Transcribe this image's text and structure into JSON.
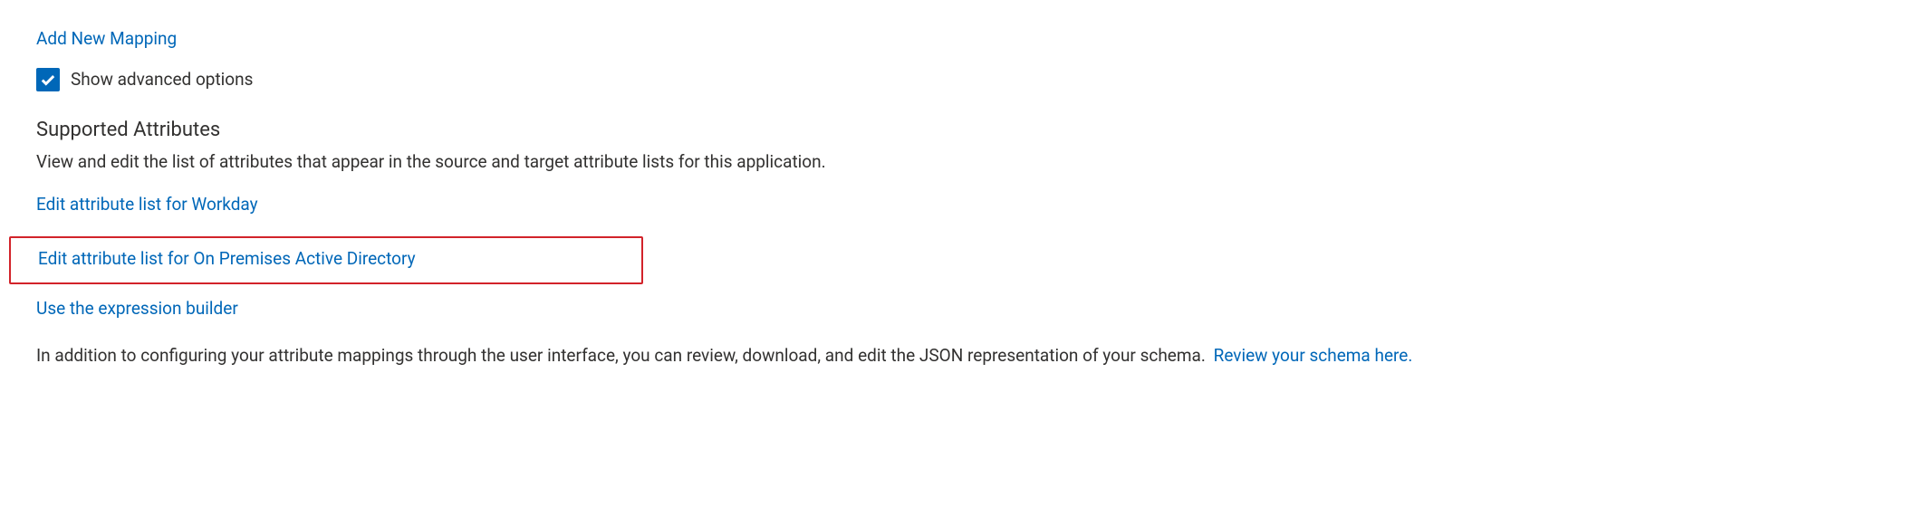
{
  "addNewMapping": "Add New Mapping",
  "showAdvancedOptions": "Show advanced options",
  "sectionHeading": "Supported Attributes",
  "sectionDescription": "View and edit the list of attributes that appear in the source and target attribute lists for this application.",
  "editWorkdayLink": "Edit attribute list for Workday",
  "editOnPremLink": "Edit attribute list for On Premises Active Directory",
  "expressionBuilderLink": "Use the expression builder",
  "footerTextPrefix": "In addition to configuring your attribute mappings through the user interface, you can review, download, and edit the JSON representation of your schema.",
  "reviewSchemaLink": "Review your schema here."
}
